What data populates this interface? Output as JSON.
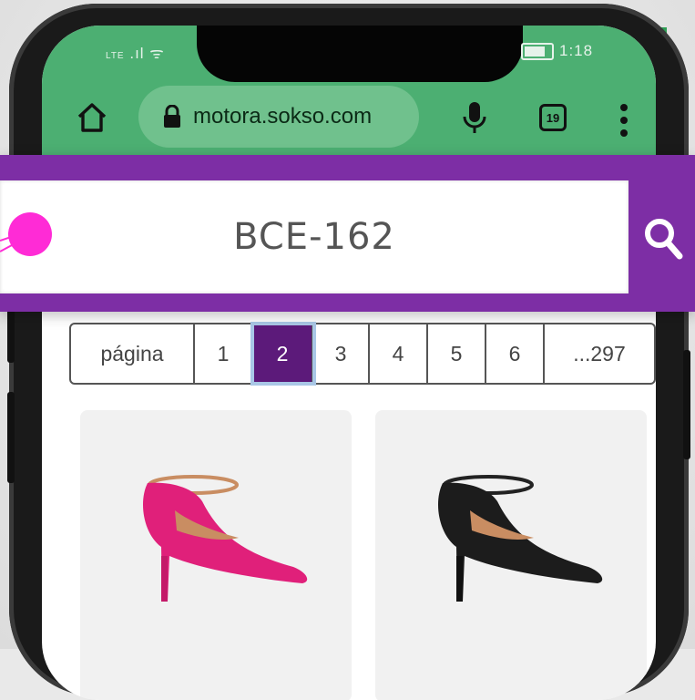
{
  "status_bar": {
    "left": "LTE",
    "time": "1:18"
  },
  "browser": {
    "url": "motora.sokso.com",
    "tab_count": "19"
  },
  "search": {
    "query": "BCE-162"
  },
  "pagination": {
    "label": "página",
    "pages": [
      "1",
      "2",
      "3",
      "4",
      "5",
      "6",
      "...297"
    ],
    "active_page": "2"
  },
  "products": [
    {
      "color": "#e0207a",
      "icon": "pink-pump-shoe"
    },
    {
      "color": "#1c1c1c",
      "icon": "black-pump-shoe"
    }
  ],
  "colors": {
    "browser_chrome": "#4caf72",
    "search_band": "#7d2ea5",
    "active_page": "#5c1a7a",
    "pointer": "#ff2bd6"
  }
}
